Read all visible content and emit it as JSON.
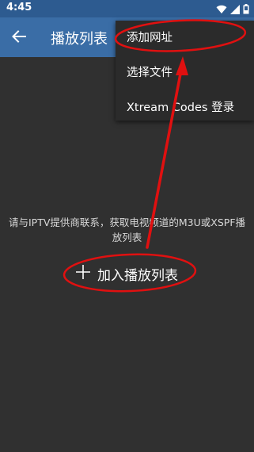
{
  "status_bar": {
    "time": "4:45",
    "icons": [
      "wifi-icon",
      "signal-icon",
      "battery-icon"
    ]
  },
  "app_bar": {
    "title": "播放列表",
    "back_icon": "arrow-left-icon"
  },
  "overflow_menu": {
    "items": [
      {
        "label": "添加网址"
      },
      {
        "label": "选择文件"
      },
      {
        "label": "Xtream Codes 登录"
      }
    ]
  },
  "main": {
    "hint": "请与IPTV提供商联系，获取电视频道的M3U或XSPF播放列表",
    "add_button": {
      "label": "加入播放列表",
      "icon": "plus-icon"
    }
  },
  "colors": {
    "status_bar": "#2d5b90",
    "app_bar": "#3a6da6",
    "background": "#303030",
    "menu": "#2b2b2b",
    "annotation": "#e01010"
  }
}
